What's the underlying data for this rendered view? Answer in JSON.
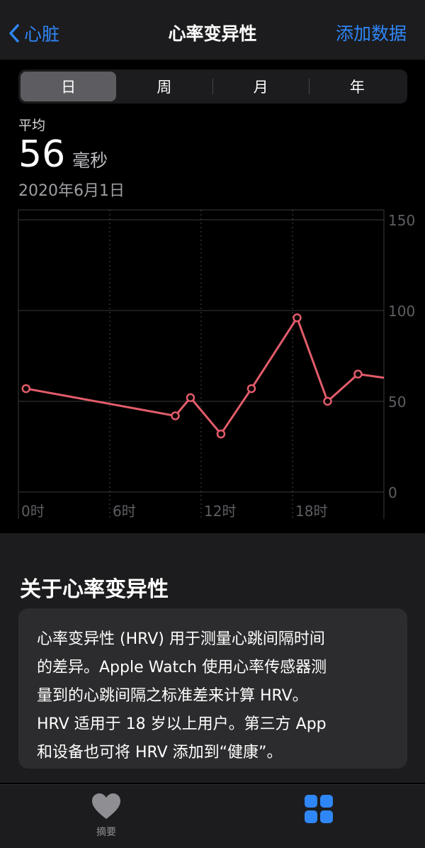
{
  "nav": {
    "back_label": "心脏",
    "title": "心率变异性",
    "add_label": "添加数据"
  },
  "segments": [
    {
      "label": "日",
      "active": true
    },
    {
      "label": "周",
      "active": false
    },
    {
      "label": "月",
      "active": false
    },
    {
      "label": "年",
      "active": false
    }
  ],
  "summary": {
    "label": "平均",
    "value": "56",
    "unit": "毫秒",
    "date": "2020年6月1日"
  },
  "chart_data": {
    "type": "line",
    "series": [
      {
        "x": [
          0.5,
          10.3,
          11.3,
          13.3,
          15.3,
          18.3,
          20.3,
          22.3,
          24
        ],
        "values": [
          57,
          42,
          52,
          32,
          57,
          96,
          50,
          65,
          63
        ]
      }
    ],
    "xlim": [
      0,
      24
    ],
    "ylim": [
      0,
      150
    ],
    "y_ticks": [
      {
        "value": 0,
        "label": "0"
      },
      {
        "value": 50,
        "label": "50"
      },
      {
        "value": 100,
        "label": "100"
      },
      {
        "value": 150,
        "label": "150"
      }
    ],
    "x_ticks": [
      {
        "value": 0,
        "label": "0时"
      },
      {
        "value": 6,
        "label": "6时"
      },
      {
        "value": 12,
        "label": "12时"
      },
      {
        "value": 18,
        "label": "18时"
      }
    ],
    "line_color": "#e25c6b",
    "grid": true
  },
  "about": {
    "title": "关于心率变异性",
    "lines": [
      "心率变异性 (HRV) 用于测量心跳间隔时间",
      "的差异。Apple Watch 使用心率传感器测",
      "量到的心跳间隔之标准差来计算 HRV。",
      "HRV 适用于 18 岁以上用户。第三方 App",
      "和设备也可将 HRV 添加到“健康”。"
    ]
  },
  "tabbar": {
    "summary_label": "摘要",
    "summary_icon": "heart-icon",
    "browse_icon": "grid-icon",
    "accent_color": "#2f86f6",
    "inactive_color": "#8e8e93"
  }
}
